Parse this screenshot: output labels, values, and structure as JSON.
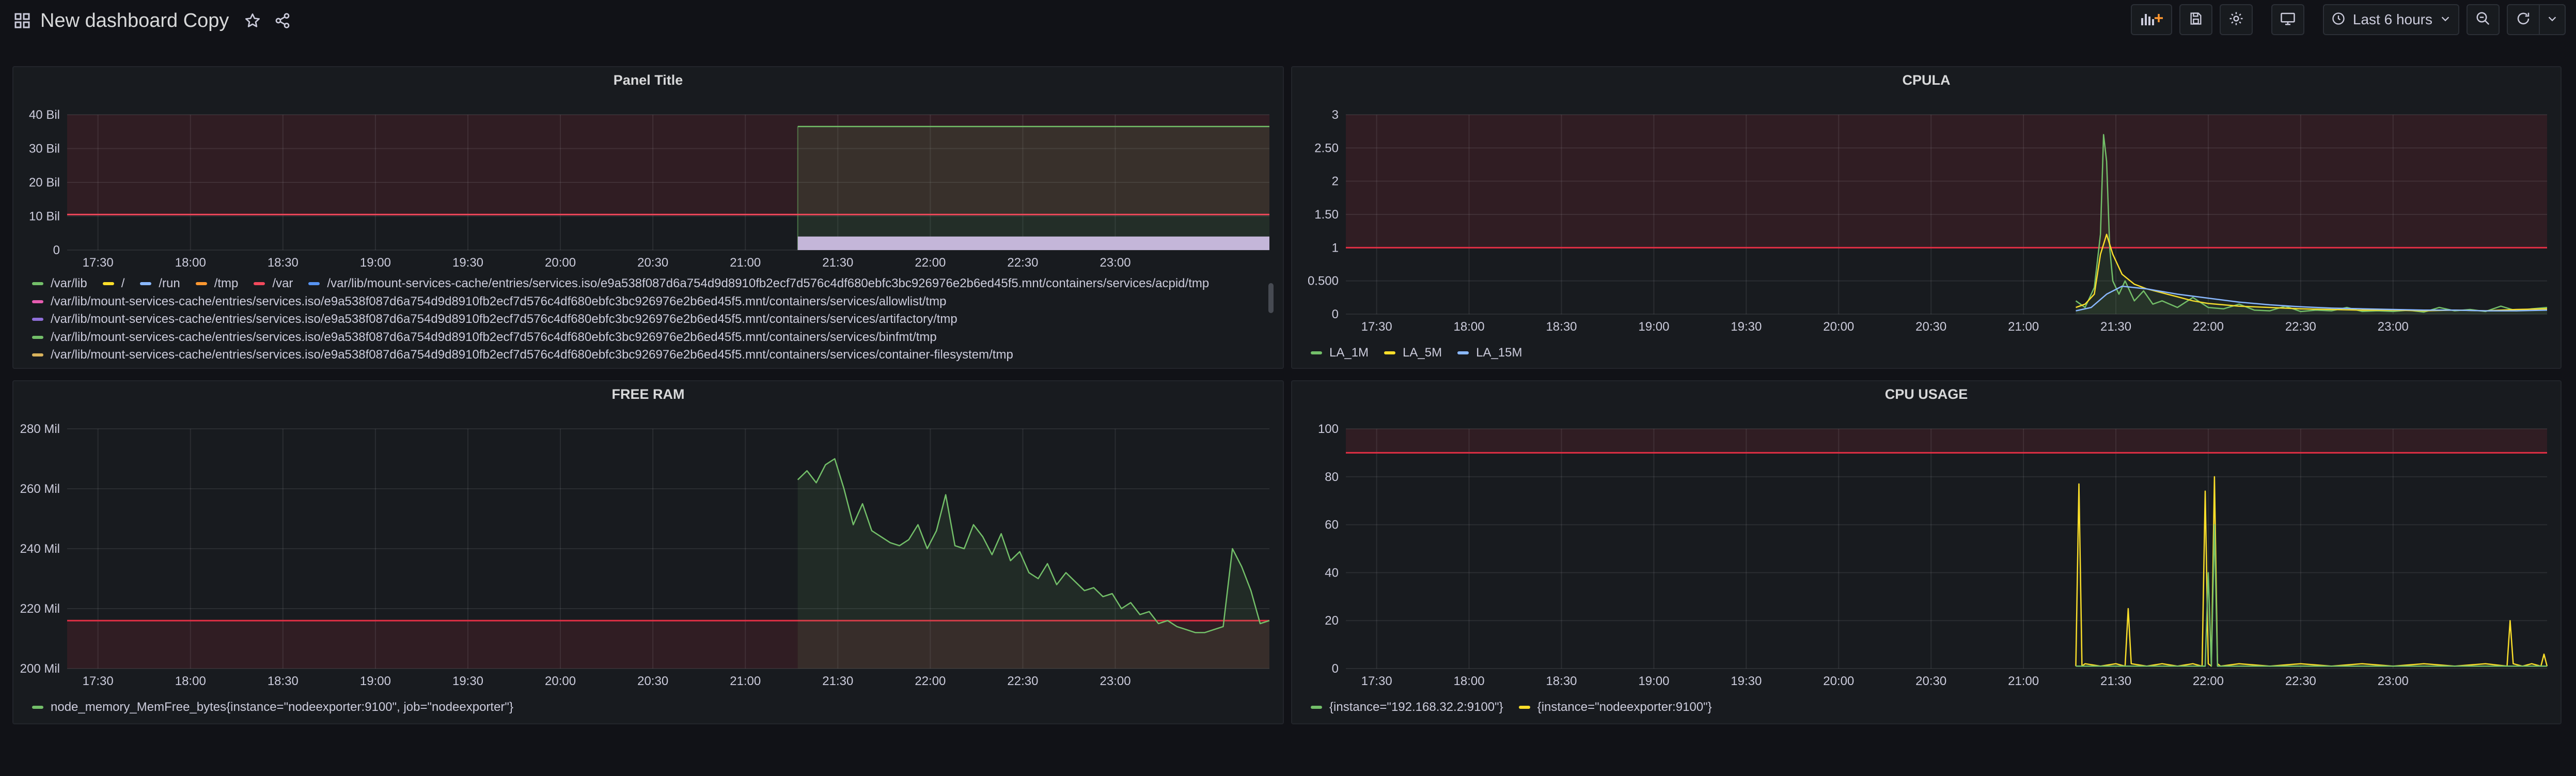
{
  "navbar": {
    "title": "New dashboard Copy",
    "time_range": "Last 6 hours",
    "icons": [
      "apps-icon",
      "star-icon",
      "share-icon",
      "add-panel-icon",
      "save-icon",
      "settings-icon",
      "tv-mode-icon",
      "clock-icon",
      "chevron-down-icon",
      "zoom-out-icon",
      "refresh-icon",
      "chevron-down-icon"
    ]
  },
  "colors": {
    "background": "#111217",
    "panel": "#181b1f",
    "threshold": "#e02f44",
    "green": "#73bf69",
    "yellow": "#fade2a",
    "blue": "#8ab8ff",
    "orange": "#ff9830",
    "red": "#f2495c",
    "purple": "#b877d9"
  },
  "time_axis": [
    "17:30",
    "18:00",
    "18:30",
    "19:00",
    "19:30",
    "20:00",
    "20:30",
    "21:00",
    "21:30",
    "22:00",
    "22:30",
    "23:00"
  ],
  "panels": {
    "panel_title": {
      "title": "Panel Title",
      "legend_row1": [
        {
          "label": "/var/lib",
          "color": "#73bf69"
        },
        {
          "label": "/",
          "color": "#fade2a"
        },
        {
          "label": "/run",
          "color": "#8ab8ff"
        },
        {
          "label": "/tmp",
          "color": "#ff9830"
        },
        {
          "label": "/var",
          "color": "#f2495c"
        },
        {
          "label": "/var/lib/mount-services-cache/entries/services.iso/e9a538f087d6a754d9d8910fb2ecf7d576c4df680ebfc3bc926976e2b6ed45f5.mnt/containers/services/acpid/tmp",
          "color": "#5794f2"
        }
      ],
      "legend_rows": [
        {
          "label": "/var/lib/mount-services-cache/entries/services.iso/e9a538f087d6a754d9d8910fb2ecf7d576c4df680ebfc3bc926976e2b6ed45f5.mnt/containers/services/allowlist/tmp",
          "color": "#e65cb0"
        },
        {
          "label": "/var/lib/mount-services-cache/entries/services.iso/e9a538f087d6a754d9d8910fb2ecf7d576c4df680ebfc3bc926976e2b6ed45f5.mnt/containers/services/artifactory/tmp",
          "color": "#8f6fd9"
        },
        {
          "label": "/var/lib/mount-services-cache/entries/services.iso/e9a538f087d6a754d9d8910fb2ecf7d576c4df680ebfc3bc926976e2b6ed45f5.mnt/containers/services/binfmt/tmp",
          "color": "#73bf69"
        },
        {
          "label": "/var/lib/mount-services-cache/entries/services.iso/e9a538f087d6a754d9d8910fb2ecf7d576c4df680ebfc3bc926976e2b6ed45f5.mnt/containers/services/container-filesystem/tmp",
          "color": "#d9b35c"
        }
      ]
    },
    "cpula": {
      "title": "CPULA",
      "legend": [
        {
          "label": "LA_1M",
          "color": "#73bf69"
        },
        {
          "label": "LA_5M",
          "color": "#fade2a"
        },
        {
          "label": "LA_15M",
          "color": "#8ab8ff"
        }
      ]
    },
    "free_ram": {
      "title": "FREE RAM",
      "legend": [
        {
          "label": "node_memory_MemFree_bytes{instance=\"nodeexporter:9100\", job=\"nodeexporter\"}",
          "color": "#73bf69"
        }
      ]
    },
    "cpu_usage": {
      "title": "CPU USAGE",
      "legend": [
        {
          "label": "{instance=\"192.168.32.2:9100\"}",
          "color": "#73bf69"
        },
        {
          "label": "{instance=\"nodeexporter:9100\"}",
          "color": "#fade2a"
        }
      ]
    }
  },
  "chart_data": [
    {
      "type": "line",
      "title": "Panel Title",
      "yticks": [
        "0",
        "10 Bil",
        "20 Bil",
        "30 Bil",
        "40 Bil"
      ],
      "ylim": [
        0,
        40
      ],
      "xlim": [
        "17:20",
        "23:50"
      ],
      "threshold": 10.5,
      "series": [
        {
          "name": "/var/lib",
          "color": "#73bf69",
          "x": [
            "21:17",
            "23:50"
          ],
          "y": [
            36.5,
            36.5
          ]
        },
        {
          "name": "/var",
          "color": "#f2495c",
          "x": [
            "17:20",
            "23:50"
          ],
          "y": [
            10.5,
            10.5
          ]
        },
        {
          "name": "/tmp",
          "color": "#c4b6d9",
          "x": [
            "21:17",
            "23:50"
          ],
          "y": [
            4,
            4
          ]
        }
      ]
    },
    {
      "type": "line",
      "title": "CPULA",
      "yticks": [
        "0",
        "0.500",
        "1",
        "1.50",
        "2",
        "2.50",
        "3"
      ],
      "ylim": [
        0,
        3
      ],
      "xlim": [
        "17:20",
        "23:50"
      ],
      "threshold": 1,
      "series": [
        {
          "name": "LA_1M",
          "color": "#73bf69",
          "x": [
            "21:17",
            "21:20",
            "21:23",
            "21:25",
            "21:26",
            "21:27",
            "21:28",
            "21:29",
            "21:31",
            "21:33",
            "21:36",
            "21:39",
            "21:42",
            "21:45",
            "21:50",
            "21:55",
            "22:00",
            "22:05",
            "22:10",
            "22:15",
            "22:20",
            "22:25",
            "22:30",
            "22:35",
            "22:40",
            "22:45",
            "22:50",
            "22:55",
            "23:00",
            "23:05",
            "23:10",
            "23:15",
            "23:20",
            "23:25",
            "23:30",
            "23:35",
            "23:40",
            "23:45",
            "23:50"
          ],
          "y": [
            0.2,
            0.1,
            0.4,
            1.2,
            2.7,
            2.3,
            1.0,
            0.5,
            0.3,
            0.5,
            0.2,
            0.35,
            0.15,
            0.2,
            0.1,
            0.25,
            0.1,
            0.08,
            0.15,
            0.06,
            0.05,
            0.12,
            0.04,
            0.06,
            0.05,
            0.1,
            0.04,
            0.05,
            0.04,
            0.06,
            0.03,
            0.1,
            0.05,
            0.07,
            0.04,
            0.12,
            0.05,
            0.08,
            0.1
          ]
        },
        {
          "name": "LA_5M",
          "color": "#fade2a",
          "x": [
            "21:17",
            "21:20",
            "21:23",
            "21:25",
            "21:27",
            "21:29",
            "21:32",
            "21:36",
            "21:40",
            "21:45",
            "21:50",
            "21:55",
            "22:00",
            "22:10",
            "22:20",
            "22:30",
            "22:40",
            "22:50",
            "23:00",
            "23:10",
            "23:20",
            "23:30",
            "23:40",
            "23:50"
          ],
          "y": [
            0.1,
            0.15,
            0.3,
            0.9,
            1.2,
            0.9,
            0.6,
            0.45,
            0.38,
            0.32,
            0.26,
            0.2,
            0.16,
            0.12,
            0.1,
            0.08,
            0.07,
            0.06,
            0.06,
            0.05,
            0.06,
            0.05,
            0.07,
            0.08
          ]
        },
        {
          "name": "LA_15M",
          "color": "#8ab8ff",
          "x": [
            "21:17",
            "21:22",
            "21:27",
            "21:32",
            "21:40",
            "21:50",
            "22:00",
            "22:10",
            "22:20",
            "22:30",
            "22:40",
            "22:50",
            "23:00",
            "23:10",
            "23:20",
            "23:30",
            "23:40",
            "23:50"
          ],
          "y": [
            0.05,
            0.1,
            0.3,
            0.42,
            0.38,
            0.3,
            0.24,
            0.18,
            0.14,
            0.11,
            0.09,
            0.08,
            0.07,
            0.06,
            0.06,
            0.05,
            0.05,
            0.06
          ]
        }
      ]
    },
    {
      "type": "area",
      "title": "FREE RAM",
      "yticks": [
        "200 Mil",
        "220 Mil",
        "240 Mil",
        "260 Mil",
        "280 Mil"
      ],
      "ylim": [
        200,
        280
      ],
      "xlim": [
        "17:20",
        "23:50"
      ],
      "threshold": 216,
      "series": [
        {
          "name": "node_memory_MemFree_bytes{instance=\"nodeexporter:9100\", job=\"nodeexporter\"}",
          "color": "#73bf69",
          "x": [
            "21:17",
            "21:20",
            "21:23",
            "21:26",
            "21:29",
            "21:32",
            "21:35",
            "21:38",
            "21:41",
            "21:44",
            "21:47",
            "21:50",
            "21:53",
            "21:56",
            "21:59",
            "22:02",
            "22:05",
            "22:08",
            "22:11",
            "22:14",
            "22:17",
            "22:20",
            "22:23",
            "22:26",
            "22:29",
            "22:32",
            "22:35",
            "22:38",
            "22:41",
            "22:44",
            "22:47",
            "22:50",
            "22:53",
            "22:56",
            "22:59",
            "23:02",
            "23:05",
            "23:08",
            "23:11",
            "23:14",
            "23:17",
            "23:20",
            "23:23",
            "23:26",
            "23:29",
            "23:32",
            "23:35",
            "23:38",
            "23:41",
            "23:44",
            "23:47",
            "23:50"
          ],
          "y": [
            263,
            266,
            262,
            268,
            270,
            260,
            248,
            255,
            246,
            244,
            242,
            241,
            243,
            248,
            240,
            246,
            258,
            241,
            240,
            248,
            244,
            238,
            245,
            236,
            239,
            232,
            230,
            235,
            228,
            232,
            229,
            226,
            227,
            224,
            225,
            220,
            222,
            218,
            219,
            215,
            216,
            214,
            213,
            212,
            212,
            213,
            214,
            240,
            234,
            226,
            215,
            216
          ]
        }
      ]
    },
    {
      "type": "line",
      "title": "CPU USAGE",
      "yticks": [
        "0",
        "20",
        "40",
        "60",
        "80",
        "100"
      ],
      "ylim": [
        0,
        100
      ],
      "xlim": [
        "17:20",
        "23:50"
      ],
      "threshold": 90,
      "series": [
        {
          "name": "{instance=\"nodeexporter:9100\"}",
          "color": "#fade2a",
          "x": [
            "21:17",
            "21:18",
            "21:19",
            "21:20",
            "21:25",
            "21:30",
            "21:33",
            "21:34",
            "21:35",
            "21:40",
            "21:45",
            "21:50",
            "21:55",
            "21:58",
            "21:59",
            "22:00",
            "22:01",
            "22:02",
            "22:03",
            "22:04",
            "22:10",
            "22:20",
            "22:30",
            "22:40",
            "22:50",
            "23:00",
            "23:10",
            "23:20",
            "23:30",
            "23:37",
            "23:38",
            "23:39",
            "23:42",
            "23:45",
            "23:48",
            "23:49",
            "23:50"
          ],
          "y": [
            1,
            77,
            1,
            2,
            1,
            2,
            1,
            25,
            2,
            1,
            2,
            1,
            2,
            1,
            74,
            2,
            1,
            80,
            2,
            1,
            2,
            1,
            2,
            1,
            2,
            1,
            2,
            1,
            2,
            1,
            20,
            2,
            1,
            2,
            1,
            6,
            1
          ]
        },
        {
          "name": "{instance=\"192.168.32.2:9100\"}",
          "color": "#73bf69",
          "x": [
            "21:17",
            "21:59",
            "22:00",
            "22:01",
            "22:02",
            "22:03",
            "23:50"
          ],
          "y": [
            1,
            1,
            40,
            1,
            60,
            1,
            1
          ]
        }
      ]
    }
  ]
}
